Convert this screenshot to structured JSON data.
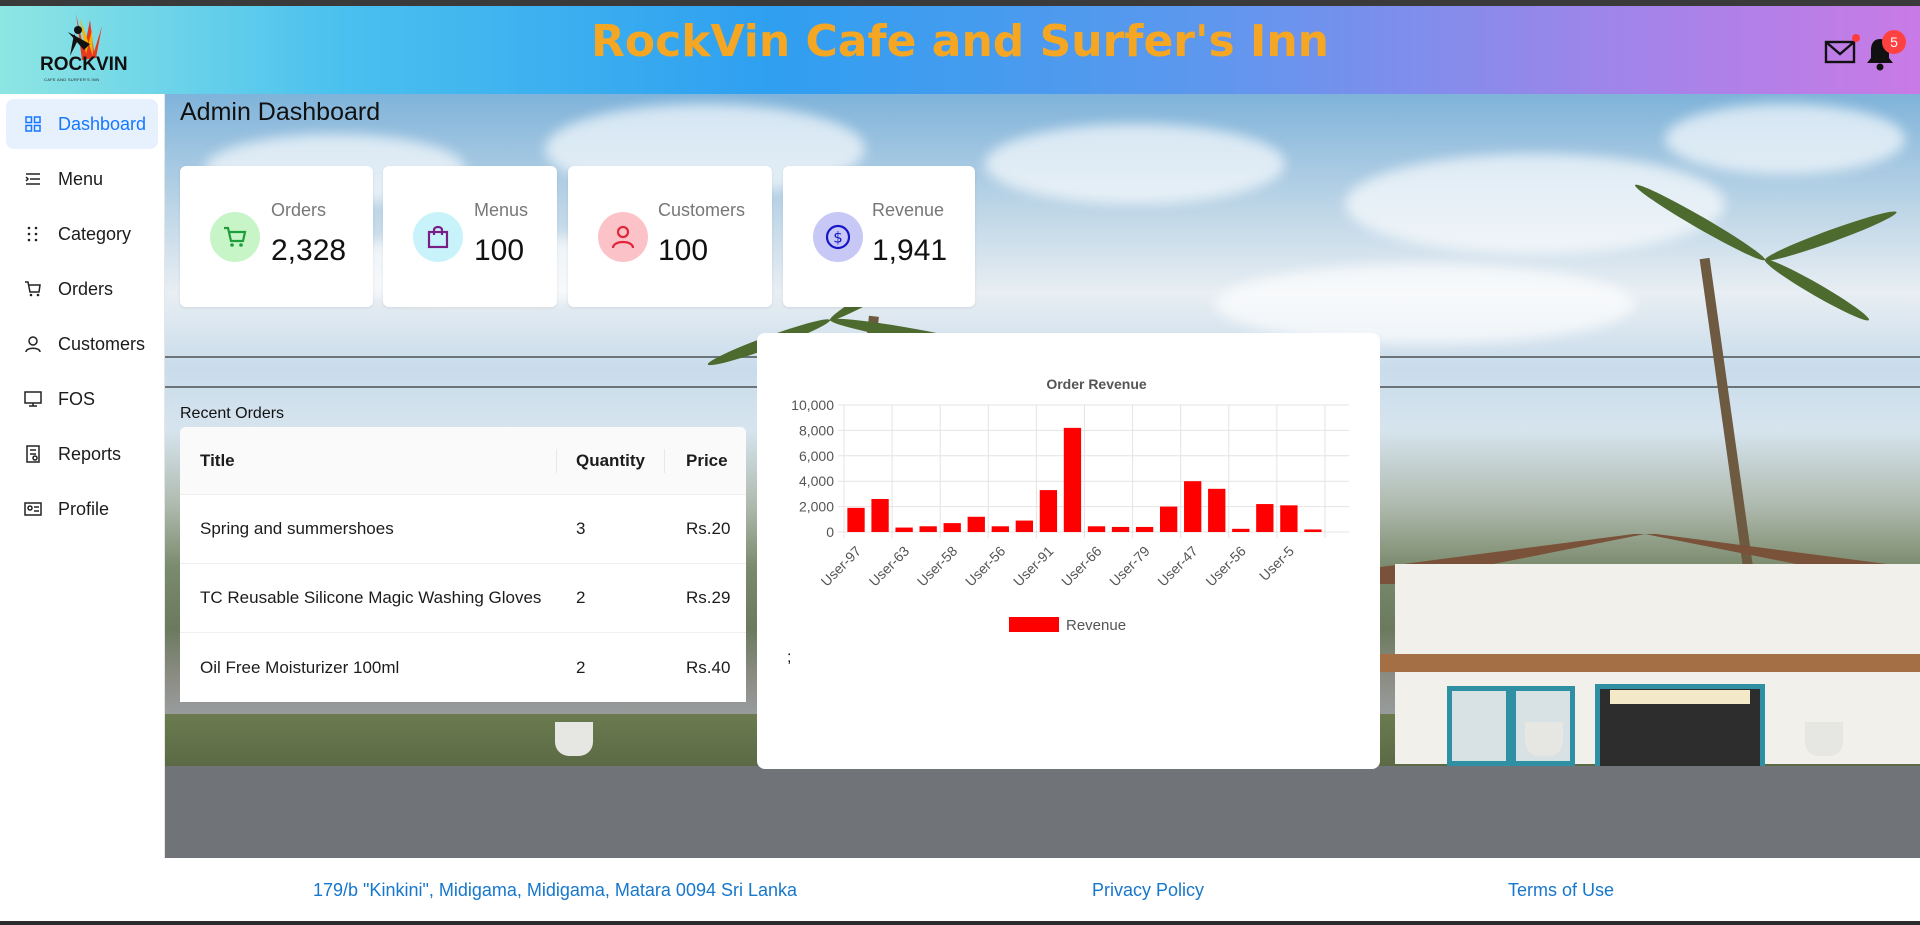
{
  "header": {
    "site_title": "RockVin Cafe and Surfer's Inn",
    "logo_text": "ROCKVIN",
    "logo_subtext": "CAFE AND SURFER'S INN",
    "notification_count": "5",
    "icons": [
      "mail-icon",
      "bell-icon"
    ]
  },
  "sidebar": {
    "items": [
      {
        "label": "Dashboard",
        "icon": "dashboard-icon",
        "active": true
      },
      {
        "label": "Menu",
        "icon": "menu-icon",
        "active": false
      },
      {
        "label": "Category",
        "icon": "category-icon",
        "active": false
      },
      {
        "label": "Orders",
        "icon": "cart-icon",
        "active": false
      },
      {
        "label": "Customers",
        "icon": "user-icon",
        "active": false
      },
      {
        "label": "FOS",
        "icon": "monitor-icon",
        "active": false
      },
      {
        "label": "Reports",
        "icon": "report-icon",
        "active": false
      },
      {
        "label": "Profile",
        "icon": "idcard-icon",
        "active": false
      }
    ]
  },
  "main": {
    "title": "Admin Dashboard",
    "stats": [
      {
        "label": "Orders",
        "value": "2,328",
        "icon": "cart-icon",
        "color": "#1e9e3a",
        "bg": "#c8f5c8"
      },
      {
        "label": "Menus",
        "value": "100",
        "icon": "shopping-bag-icon",
        "color": "#7a1e86",
        "bg": "#c9f3fb"
      },
      {
        "label": "Customers",
        "value": "100",
        "icon": "user-icon",
        "color": "#e0263a",
        "bg": "#fbc3c8"
      },
      {
        "label": "Revenue",
        "value": "1,941",
        "icon": "dollar-icon",
        "color": "#1515c8",
        "bg": "#c8c8f7"
      }
    ],
    "recent_orders_label": "Recent Orders",
    "table": {
      "headers": [
        "Title",
        "Quantity",
        "Price"
      ],
      "rows": [
        [
          "Spring and summershoes",
          "3",
          "Rs.20"
        ],
        [
          "TC Reusable Silicone Magic Washing Gloves",
          "2",
          "Rs.29"
        ],
        [
          "Oil Free Moisturizer 100ml",
          "2",
          "Rs.40"
        ]
      ]
    },
    "chart_trailing_text": ";"
  },
  "chart_data": {
    "type": "bar",
    "title": "Order Revenue",
    "xlabel": "",
    "ylabel": "",
    "ylim": [
      0,
      10000
    ],
    "yticks": [
      "0",
      "2,000",
      "4,000",
      "6,000",
      "8,000",
      "10,000"
    ],
    "categories": [
      "User-97",
      "",
      "User-63",
      "",
      "User-58",
      "",
      "User-56",
      "",
      "User-91",
      "",
      "User-66",
      "",
      "User-79",
      "",
      "User-47",
      "",
      "User-56",
      "",
      "User-5",
      "",
      ""
    ],
    "series": [
      {
        "name": "Revenue",
        "color": "#ff0000",
        "values": [
          1900,
          2600,
          350,
          450,
          700,
          1200,
          450,
          900,
          3300,
          8200,
          450,
          400,
          400,
          2000,
          4000,
          3400,
          250,
          2200,
          2100,
          200
        ]
      }
    ],
    "grid": true,
    "legend": "bottom"
  },
  "footer": {
    "address": "179/b \"Kinkini\", Midigama, Midigama, Matara 0094 Sri Lanka",
    "privacy": "Privacy Policy",
    "terms": "Terms of Use"
  }
}
